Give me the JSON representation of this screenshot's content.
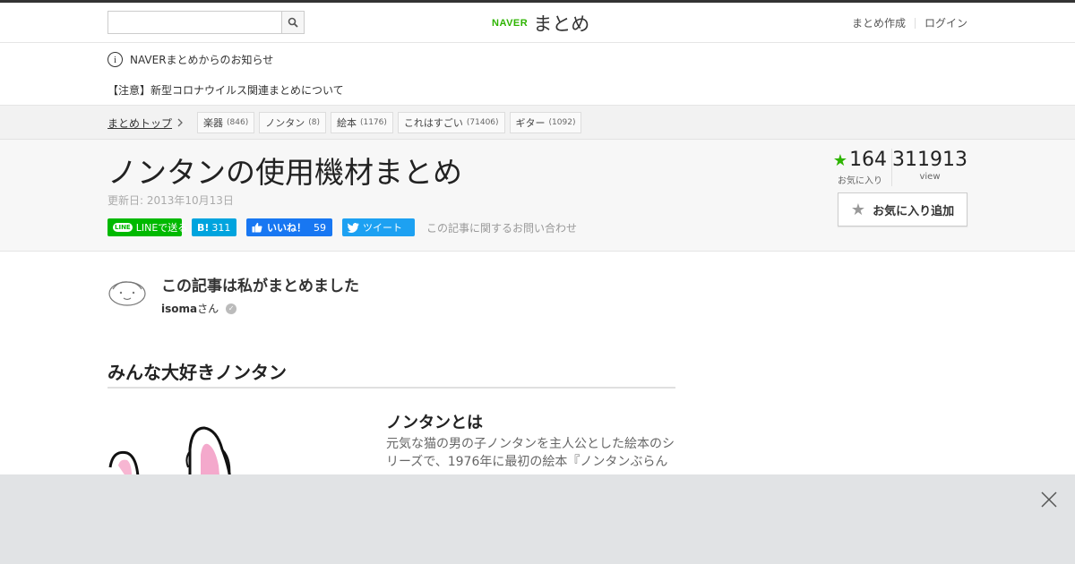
{
  "header": {
    "search_placeholder": "",
    "logo_naver": "NAVER",
    "logo_matome": "まとめ",
    "links": [
      "まとめ作成",
      "ログイン"
    ]
  },
  "notice": {
    "info_icon_glyph": "i",
    "heading": "NAVERまとめからのお知らせ",
    "message": "【注意】新型コロナウイルス関連まとめについて"
  },
  "breadcrumb": {
    "home": "まとめトップ",
    "tags": [
      {
        "label": "楽器",
        "count": "(846)"
      },
      {
        "label": "ノンタン",
        "count": "(8)"
      },
      {
        "label": "絵本",
        "count": "(1176)"
      },
      {
        "label": "これはすごい",
        "count": "(71406)"
      },
      {
        "label": "ギター",
        "count": "(1092)"
      }
    ]
  },
  "article": {
    "title": "ノンタンの使用機材まとめ",
    "updated": "更新日: 2013年10月13日",
    "favorites_count": "164",
    "favorites_label": "お気に入り",
    "view_count": "311913",
    "view_label": "view",
    "fav_add_label": "お気に入り追加"
  },
  "share": {
    "line_badge": "LINE",
    "line_label": "LINEで送る",
    "hatena_label": "B!",
    "hatena_count": "311",
    "fb_label": "いいね！",
    "fb_count": "59",
    "tweet_label": "ツイート",
    "contact_label": "この記事に関するお問い合わせ"
  },
  "author": {
    "heading": "この記事は私がまとめました",
    "name": "isoma",
    "suffix": "さん"
  },
  "content": {
    "section_heading": "みんな大好きノンタン",
    "item_title": "ノンタンとは",
    "item_desc": "元気な猫の男の子ノンタンを主人公とした絵本のシリーズで、1976年に最初の絵本『ノンタンぶらん"
  },
  "colors": {
    "brand_green": "#2db400",
    "line_green": "#00b900",
    "hatena_blue": "#00a4de",
    "facebook_blue": "#1877f2",
    "twitter_blue": "#1da1f2",
    "overlay_gray": "#e1e3e5"
  },
  "icons": [
    "search-icon",
    "info-icon",
    "chevron-right-icon",
    "star-icon",
    "verified-icon",
    "close-icon",
    "like-thumb-icon",
    "twitter-bird-icon"
  ]
}
